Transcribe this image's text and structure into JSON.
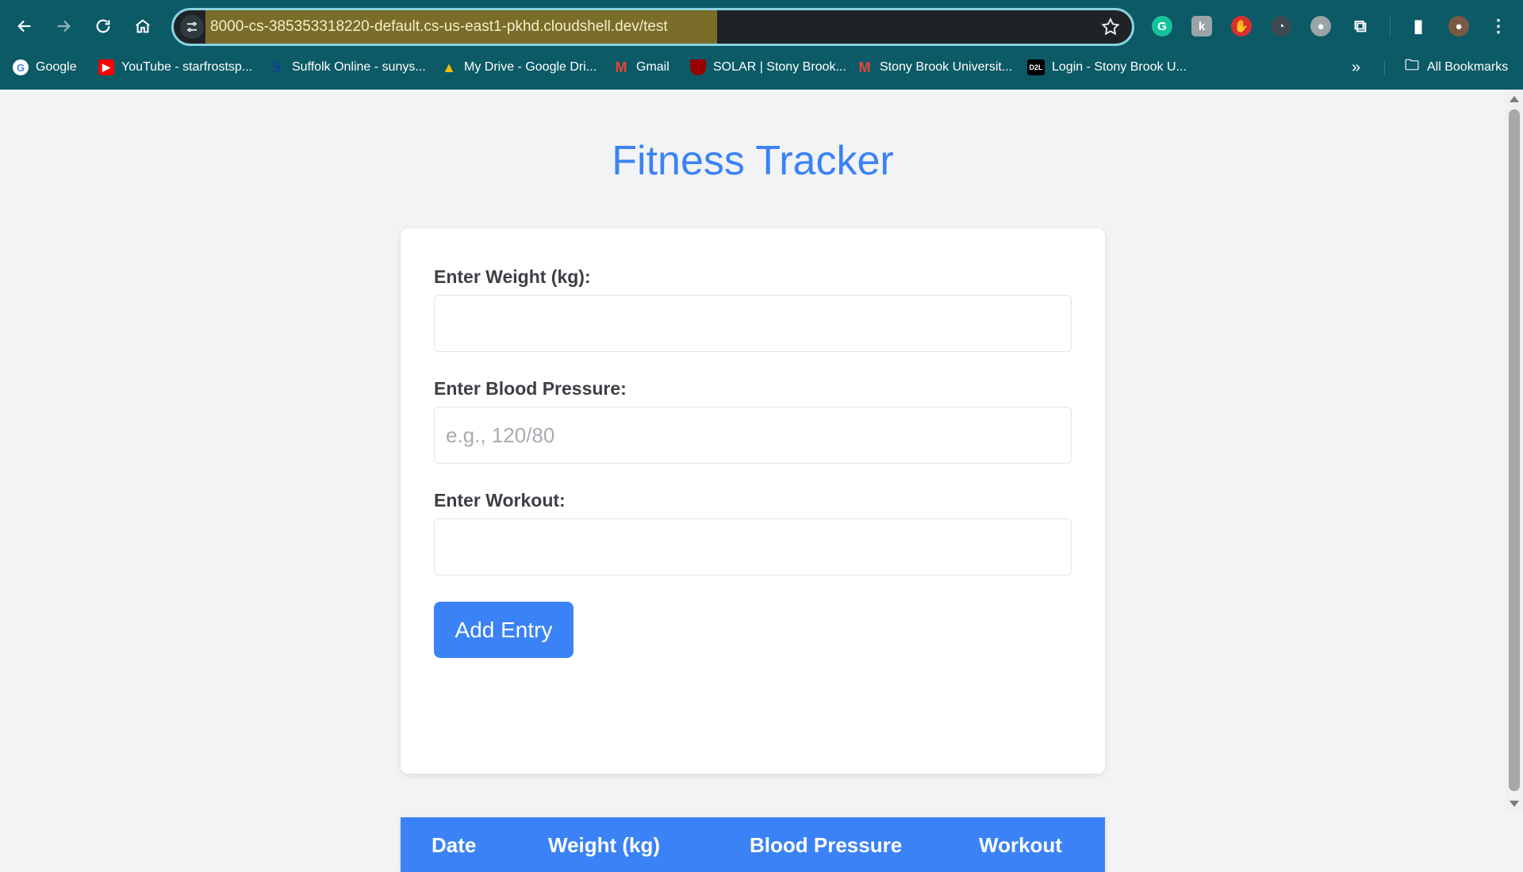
{
  "browser": {
    "url": "8000-cs-385353318220-default.cs-us-east1-pkhd.cloudshell.dev/test",
    "bookmarks": [
      {
        "label": "Google",
        "icon": "google-icon",
        "color": "#ffffff"
      },
      {
        "label": "YouTube - starfrostsp...",
        "icon": "youtube-icon",
        "color": "#ff0000"
      },
      {
        "label": "Suffolk Online - sunys...",
        "icon": "suffolk-icon",
        "color": "#1a3a9c"
      },
      {
        "label": "My Drive - Google Dri...",
        "icon": "google-drive-icon",
        "color": "#34a853"
      },
      {
        "label": "Gmail",
        "icon": "gmail-icon",
        "color": "#ea4335"
      },
      {
        "label": "SOLAR | Stony Brook...",
        "icon": "stony-brook-shield-icon",
        "color": "#990000"
      },
      {
        "label": "Stony Brook Universit...",
        "icon": "gmail-icon",
        "color": "#ea4335"
      },
      {
        "label": "Login - Stony Brook U...",
        "icon": "d2l-icon",
        "color": "#000000"
      }
    ],
    "all_bookmarks_label": "All Bookmarks"
  },
  "page": {
    "title": "Fitness Tracker",
    "form": {
      "weight_label": "Enter Weight (kg):",
      "weight_value": "",
      "bp_label": "Enter Blood Pressure:",
      "bp_placeholder": "e.g., 120/80",
      "workout_label": "Enter Workout:",
      "workout_value": "",
      "submit_label": "Add Entry"
    },
    "table": {
      "headers": [
        "Date",
        "Weight (kg)",
        "Blood Pressure",
        "Workout"
      ]
    }
  },
  "colors": {
    "accent": "#3b82f6",
    "browser_chrome": "#0b5a66",
    "page_background": "#f2f3f5"
  }
}
